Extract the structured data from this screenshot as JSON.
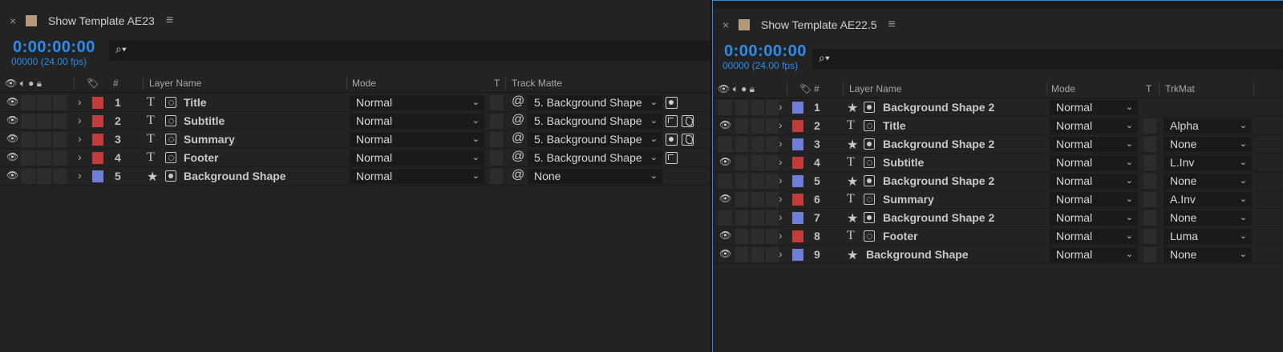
{
  "left": {
    "tab": {
      "close": "×",
      "title": "Show Template AE23",
      "menu": "≡"
    },
    "timecode": "0:00:00:00",
    "fps": "00000 (24.00 fps)",
    "search": {
      "icon": "search-icon",
      "glyph": "⌕▾"
    },
    "header": {
      "num": "#",
      "layer_name": "Layer Name",
      "mode": "Mode",
      "t": "T",
      "track_matte": "Track Matte"
    },
    "rows": [
      {
        "num": "1",
        "type": "T",
        "name": "Title",
        "color": "#c23c3c",
        "mode": "Normal",
        "matte": "5. Background Shape",
        "icons": [
          "dot"
        ]
      },
      {
        "num": "2",
        "type": "T",
        "name": "Subtitle",
        "color": "#c23c3c",
        "mode": "Normal",
        "matte": "5. Background Shape",
        "icons": [
          "corner",
          "leaf"
        ]
      },
      {
        "num": "3",
        "type": "T",
        "name": "Summary",
        "color": "#c23c3c",
        "mode": "Normal",
        "matte": "5. Background Shape",
        "icons": [
          "dot",
          "leaf"
        ]
      },
      {
        "num": "4",
        "type": "T",
        "name": "Footer",
        "color": "#c23c3c",
        "mode": "Normal",
        "matte": "5. Background Shape",
        "icons": [
          "corner"
        ]
      },
      {
        "num": "5",
        "type": "★",
        "name": "Background Shape",
        "color": "#6f7fd8",
        "mode": "Normal",
        "matte": "None",
        "icons": []
      }
    ]
  },
  "right": {
    "tab": {
      "close": "×",
      "title": "Show Template AE22.5",
      "menu": "≡"
    },
    "timecode": "0:00:00:00",
    "fps": "00000 (24.00 fps)",
    "search": {
      "icon": "search-icon",
      "glyph": "⌕▾"
    },
    "header": {
      "num": "#",
      "layer_name": "Layer Name",
      "mode": "Mode",
      "t": "T",
      "trkmat": "TrkMat"
    },
    "rows": [
      {
        "num": "1",
        "type": "★",
        "name": "Background Shape 2",
        "color": "#6f7fd8",
        "mode": "Normal",
        "trkmat": "",
        "eye": false
      },
      {
        "num": "2",
        "type": "T",
        "name": "Title",
        "color": "#c23c3c",
        "mode": "Normal",
        "trkmat": "Alpha",
        "eye": true
      },
      {
        "num": "3",
        "type": "★",
        "name": "Background Shape 2",
        "color": "#6f7fd8",
        "mode": "Normal",
        "trkmat": "None",
        "eye": false
      },
      {
        "num": "4",
        "type": "T",
        "name": "Subtitle",
        "color": "#c23c3c",
        "mode": "Normal",
        "trkmat": "L.Inv",
        "eye": true
      },
      {
        "num": "5",
        "type": "★",
        "name": "Background Shape 2",
        "color": "#6f7fd8",
        "mode": "Normal",
        "trkmat": "None",
        "eye": false
      },
      {
        "num": "6",
        "type": "T",
        "name": "Summary",
        "color": "#c23c3c",
        "mode": "Normal",
        "trkmat": "A.Inv",
        "eye": true
      },
      {
        "num": "7",
        "type": "★",
        "name": "Background Shape 2",
        "color": "#6f7fd8",
        "mode": "Normal",
        "trkmat": "None",
        "eye": false
      },
      {
        "num": "8",
        "type": "T",
        "name": "Footer",
        "color": "#c23c3c",
        "mode": "Normal",
        "trkmat": "Luma",
        "eye": true
      },
      {
        "num": "9",
        "type": "★",
        "name": "Background Shape",
        "color": "#6f7fd8",
        "mode": "Normal",
        "trkmat": "None",
        "eye": true
      }
    ]
  }
}
